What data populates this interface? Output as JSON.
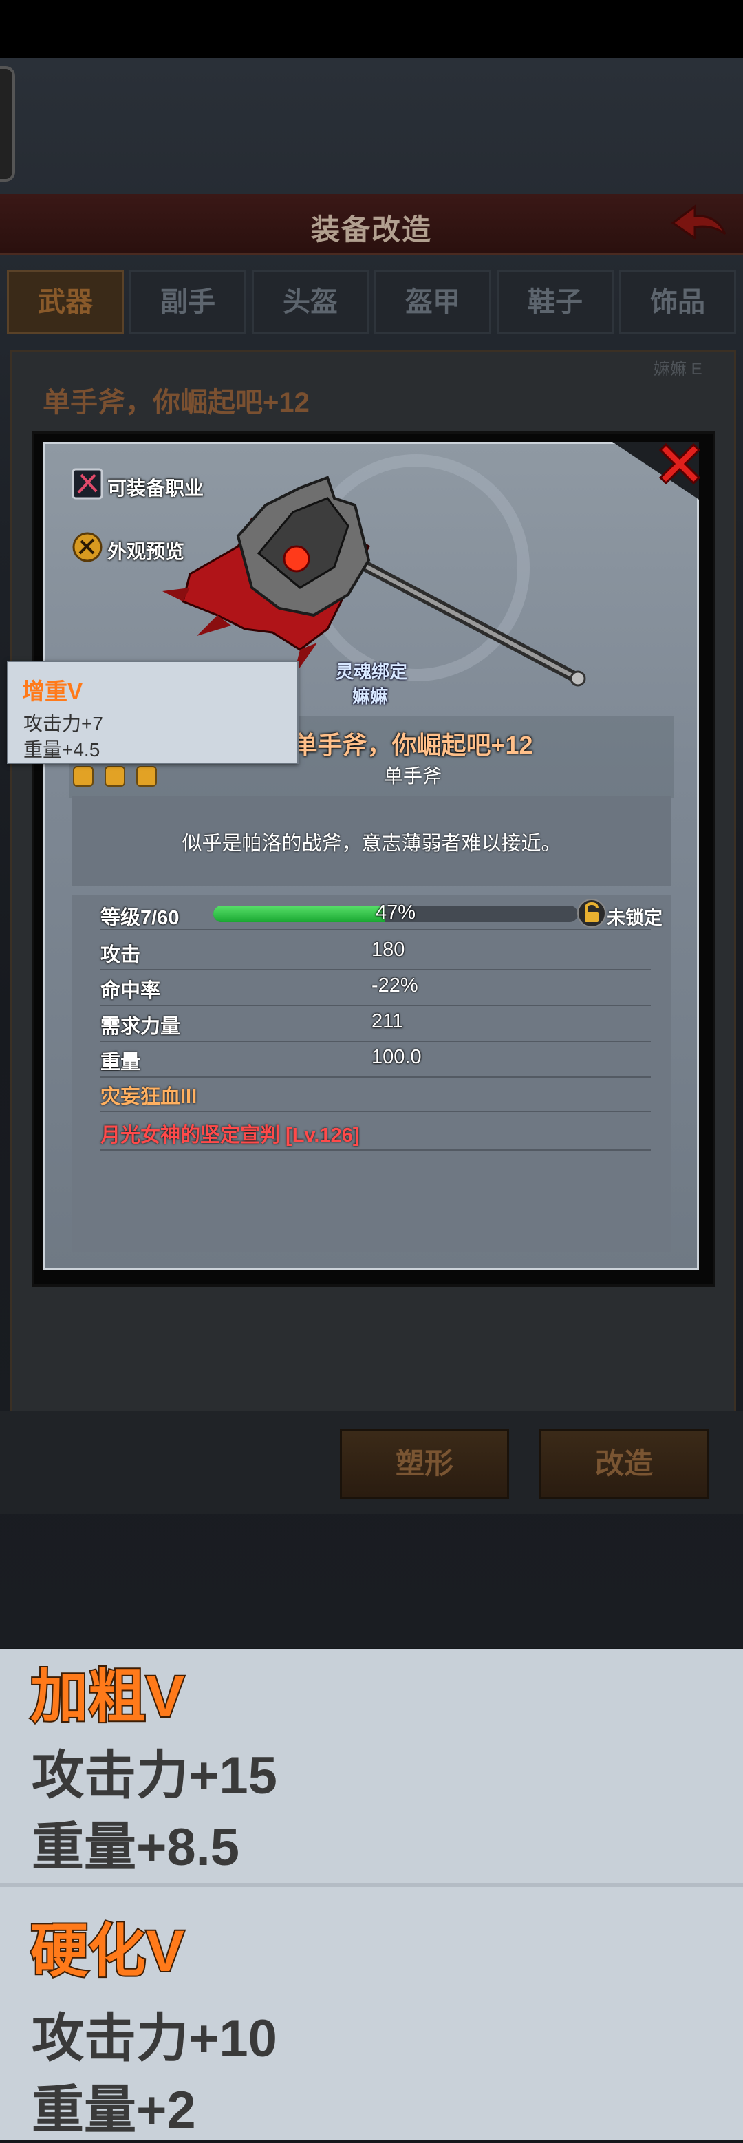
{
  "header": {
    "title": "装备改造"
  },
  "tabs": [
    {
      "label": "武器",
      "active": true
    },
    {
      "label": "副手",
      "active": false
    },
    {
      "label": "头盔",
      "active": false
    },
    {
      "label": "盔甲",
      "active": false
    },
    {
      "label": "鞋子",
      "active": false
    },
    {
      "label": "饰品",
      "active": false
    }
  ],
  "background_card": {
    "title": "单手斧，你崛起吧+12",
    "tag": "嫲嫲 E"
  },
  "dialog": {
    "menu": {
      "classes_label": "可装备职业",
      "preview_label": "外观预览"
    },
    "soul_bound": {
      "line1": "灵魂绑定",
      "line2": "嫲嫲"
    },
    "item": {
      "name": "单手斧，你崛起吧+12",
      "type": "单手斧",
      "gem_slots": 3,
      "description": "似乎是帕洛的战斧，意志薄弱者难以接近。"
    },
    "level": {
      "label": "等级7/60",
      "percent": 47,
      "percent_text": "47%",
      "lock_label": "未锁定"
    },
    "stats": [
      {
        "label": "攻击",
        "value": "180"
      },
      {
        "label": "命中率",
        "value": "-22%"
      },
      {
        "label": "需求力量",
        "value": "211"
      },
      {
        "label": "重量",
        "value": "100.0"
      }
    ],
    "affixes": [
      "灾妄狂血III",
      "月光女神的坚定宣判 [Lv.126]"
    ]
  },
  "tooltip": {
    "title": "增重V",
    "line1": "攻击力+7",
    "line2": "重量+4.5"
  },
  "buttons": {
    "shape": "塑形",
    "reforge": "改造"
  },
  "enlarged": [
    {
      "title": "加粗V",
      "line1": "攻击力+15",
      "line2": "重量+8.5"
    },
    {
      "title": "硬化V",
      "line1": "攻击力+10",
      "line2": "重量+2"
    }
  ],
  "colors": {
    "accent_orange": "#ff7a1a",
    "affix_red": "#ff4a4a",
    "level_green": "#2cc04a"
  }
}
